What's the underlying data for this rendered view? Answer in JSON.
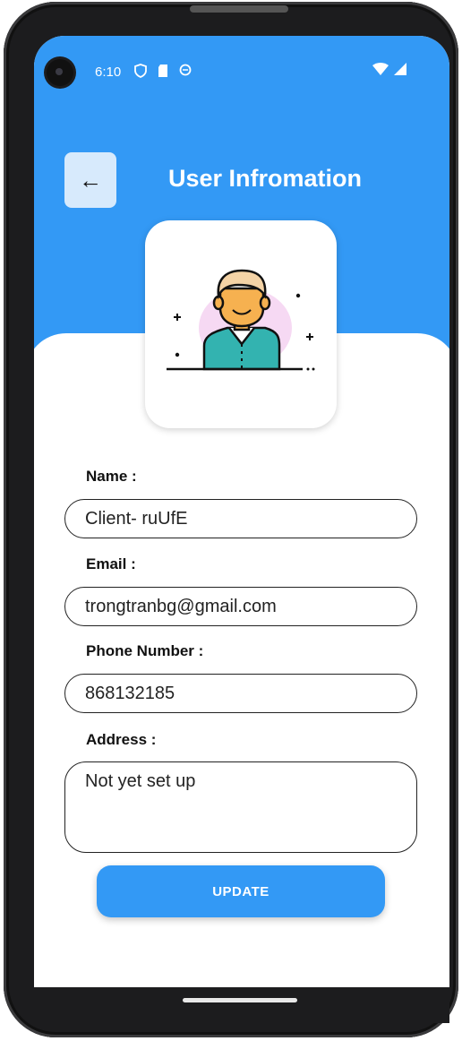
{
  "status_bar": {
    "time": "6:10",
    "icons": [
      "shield-icon",
      "sd-card-icon",
      "sync-icon"
    ],
    "right_icons": [
      "wifi-icon",
      "signal-icon"
    ]
  },
  "header": {
    "back_icon": "←",
    "title": "User Infromation"
  },
  "avatar": {
    "icon": "user-avatar-icon"
  },
  "form": {
    "name_label": "Name :",
    "name_value": "Client- ruUfE",
    "email_label": "Email :",
    "email_value": "trongtranbg@gmail.com",
    "phone_label": "Phone Number :",
    "phone_value": "868132185",
    "address_label": "Address :",
    "address_value": "Not yet set up"
  },
  "update_button": {
    "label": "UPDATE"
  },
  "colors": {
    "primary": "#3399f5",
    "back_button_bg": "#d7eafc"
  }
}
